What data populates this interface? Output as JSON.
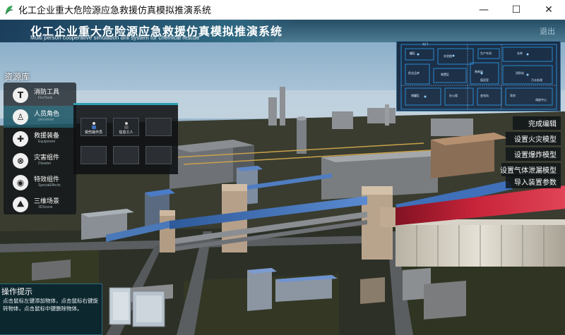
{
  "window": {
    "title": "化工企业重大危险源应急救援仿真模拟推演系统",
    "controls": {
      "minimize": "—",
      "maximize": "☐",
      "close": "✕"
    }
  },
  "header": {
    "title": "化工企业重大危险源应急救援仿真模拟推演系统",
    "subtitle": "Multi person cooperative simulation drill system for chemical rescue",
    "exit_label": "退出"
  },
  "sidebar": {
    "label": "资源库",
    "items": [
      {
        "cn": "消防工具",
        "en": "FireTools",
        "icon": "T",
        "active": false
      },
      {
        "cn": "人员角色",
        "en": "personnel",
        "icon": "♙",
        "active": true
      },
      {
        "cn": "救援装备",
        "en": "Equipment",
        "icon": "✚",
        "active": false
      },
      {
        "cn": "灾害组件",
        "en": "Disaster",
        "icon": "⊗",
        "active": false
      },
      {
        "cn": "特效组件",
        "en": "SpecialEffects",
        "icon": "◉",
        "active": false
      },
      {
        "cn": "三维场景",
        "en": "3DScene",
        "icon": "⛰",
        "active": false
      }
    ]
  },
  "assets": {
    "cells": [
      {
        "name": "受伤操作员",
        "filled": true
      },
      {
        "name": "信息工人",
        "filled": true
      },
      {
        "name": "",
        "filled": false
      },
      {
        "name": "",
        "filled": false
      },
      {
        "name": "",
        "filled": false
      },
      {
        "name": "",
        "filled": false
      }
    ]
  },
  "minimap": {
    "labels": [
      "大门",
      "罐区",
      "实验楼",
      "生产车间",
      "仓库",
      "危化品库",
      "装置区",
      "装卸站",
      "消防站",
      "值班室",
      "污水处理",
      "储罐区",
      "办公楼",
      "变电站",
      "泵房",
      "调度中心"
    ]
  },
  "actions": [
    "完成编辑",
    "设置火灾模型",
    "设置爆炸模型",
    "设置气体泄漏模型",
    "导入装置参数"
  ],
  "tips": {
    "title": "操作提示",
    "body": "点击鼠标左键添加物体，点击鼠标右键旋转物体，点击鼠标中键删除物体。"
  },
  "colors": {
    "header_band": "#1e4a66",
    "accent": "#2f9fb3",
    "pipe_red": "#b11a2a",
    "pipe_blue": "#3f6fb8"
  }
}
